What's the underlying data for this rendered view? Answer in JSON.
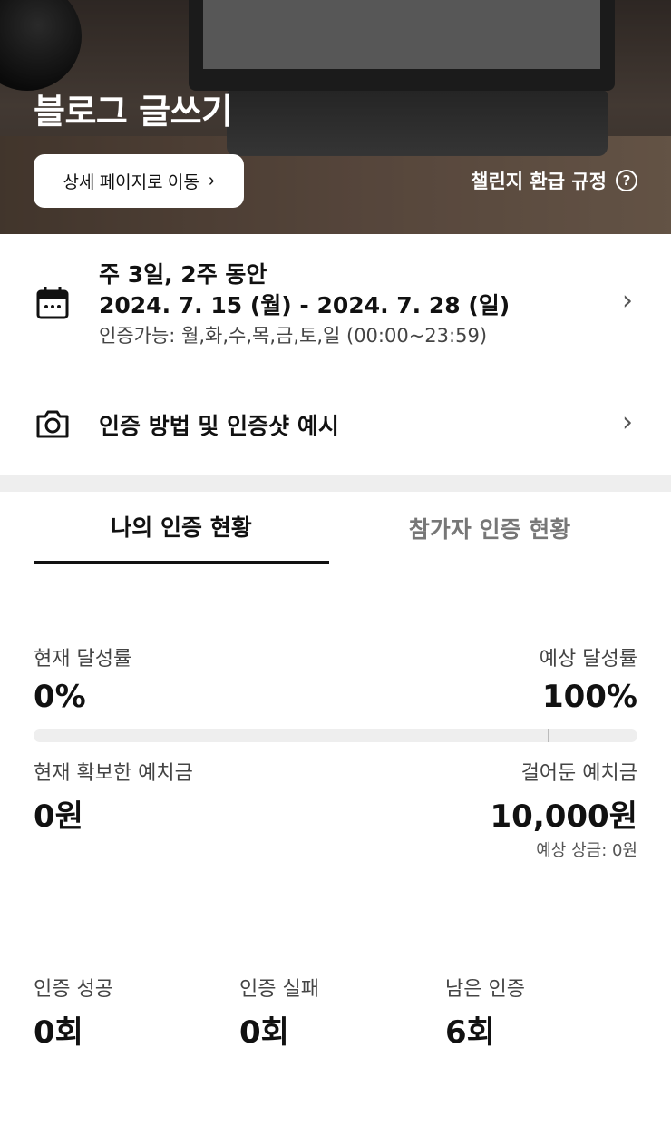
{
  "hero": {
    "title": "블로그 글쓰기",
    "detail_button": "상세 페이지로 이동",
    "refund_link": "챌린지 환급 규정"
  },
  "schedule": {
    "frequency": "주 3일, 2주 동안",
    "period": "2024. 7. 15 (월) - 2024. 7. 28 (일)",
    "available": "인증가능: 월,화,수,목,금,토,일 (00:00~23:59)"
  },
  "proof": {
    "label": "인증 방법 및 인증샷 예시"
  },
  "tabs": [
    {
      "label": "나의 인증 현황",
      "active": true
    },
    {
      "label": "참가자 인증 현황",
      "active": false
    }
  ],
  "stats": {
    "current_rate_label": "현재 달성률",
    "current_rate": "0%",
    "expected_rate_label": "예상 달성률",
    "expected_rate": "100%",
    "progress_fraction": 0,
    "secured_deposit_label": "현재 확보한 예치금",
    "secured_deposit": "0원",
    "deposit_label": "걸어둔 예치금",
    "deposit": "10,000원",
    "expected_prize": "예상 상금: 0원"
  },
  "counts": {
    "success_label": "인증 성공",
    "success": "0회",
    "fail_label": "인증 실패",
    "fail": "0회",
    "remaining_label": "남은 인증",
    "remaining": "6회"
  }
}
